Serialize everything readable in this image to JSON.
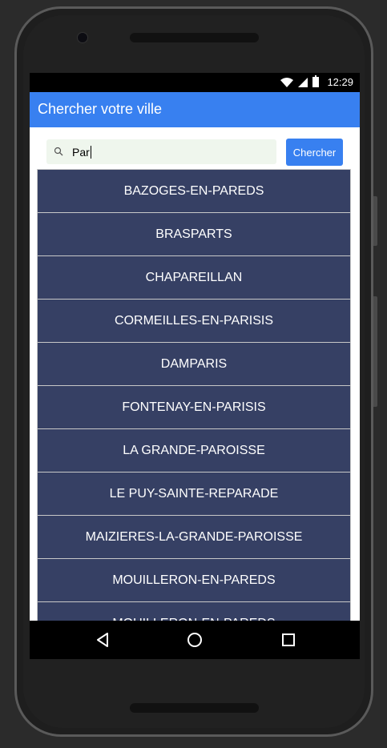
{
  "status_bar": {
    "time": "12:29",
    "icons": [
      "wifi-icon",
      "signal-icon",
      "battery-icon"
    ]
  },
  "app_bar": {
    "title": "Chercher votre ville"
  },
  "search": {
    "value": "Par",
    "icon": "search-icon",
    "button_label": "Chercher"
  },
  "results": [
    "BAZOGES-EN-PAREDS",
    "BRASPARTS",
    "CHAPAREILLAN",
    "CORMEILLES-EN-PARISIS",
    "DAMPARIS",
    "FONTENAY-EN-PARISIS",
    "LA GRANDE-PAROISSE",
    "LE PUY-SAINTE-REPARADE",
    "MAIZIERES-LA-GRANDE-PAROISSE",
    "MOUILLERON-EN-PAREDS",
    "MOUILLERON-EN-PAREDS"
  ],
  "nav_bar": {
    "icons": [
      "back-icon",
      "home-icon",
      "recent-apps-icon"
    ]
  },
  "colors": {
    "app_bar": "#3880f0",
    "list_item": "#364064",
    "search_field": "#eff6ed"
  }
}
